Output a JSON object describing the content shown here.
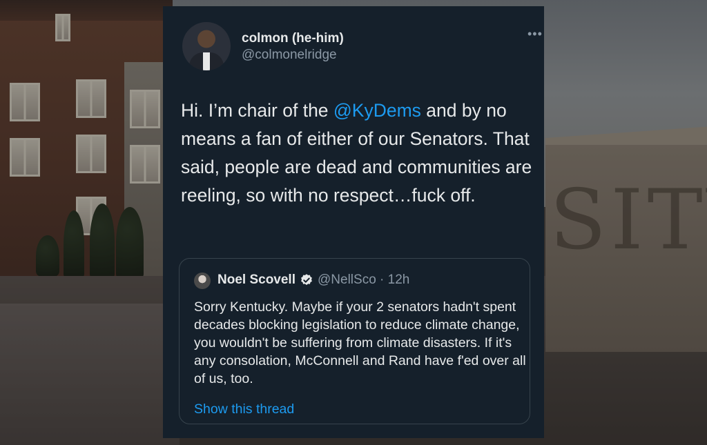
{
  "tweet": {
    "display_name": "colmon (he-him)",
    "handle": "@colmonelridge",
    "more_icon": "more-dots-icon",
    "text_before": "Hi. I’m chair of the ",
    "mention": "@KyDems",
    "text_after": " and by no means a fan of either of our Senators. That said, people are dead and communities are reeling, so with no respect…fuck off."
  },
  "quoted_tweet": {
    "display_name": "Noel Scovell",
    "verified_icon": "verified-badge-icon",
    "meta": "@NellSco · 12h",
    "text": "Sorry Kentucky. Maybe if your 2 senators hadn't spent decades blocking legislation to reduce climate change, you wouldn't be suffering from climate disasters. If it's any consolation, McConnell and Rand have f'ed over all of us, too.",
    "show_thread": "Show this thread"
  },
  "background": {
    "wall_letters": "SITY"
  },
  "colors": {
    "card_bg": "#15202b",
    "text": "#e7e9ea",
    "secondary": "#8b98a5",
    "link": "#1d9bf0",
    "border": "#38444d"
  }
}
